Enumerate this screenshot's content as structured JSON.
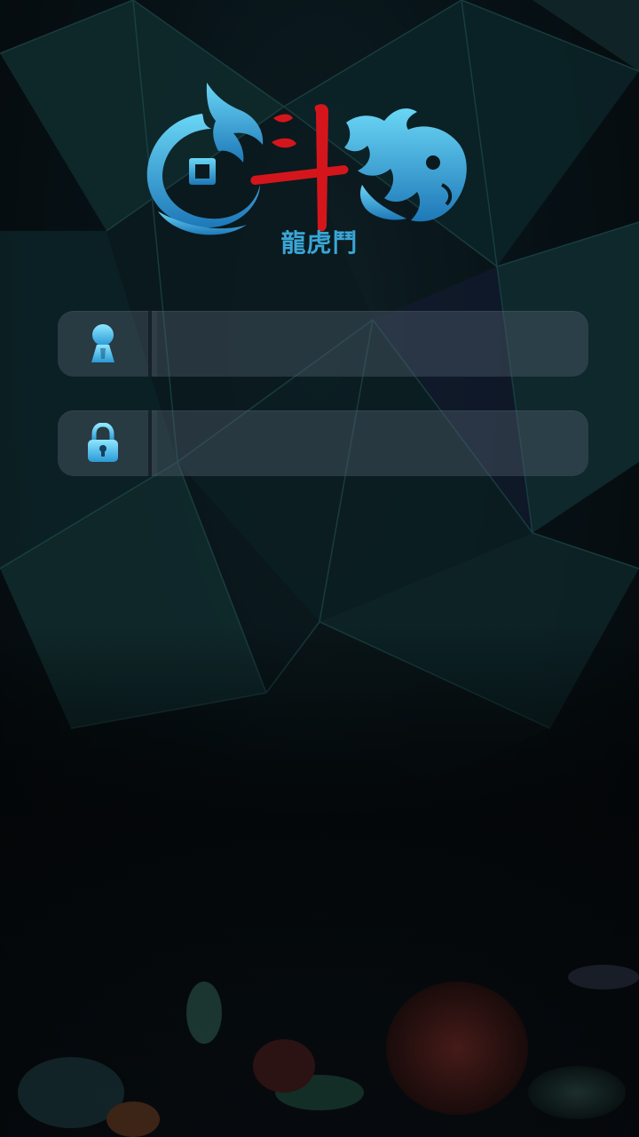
{
  "app": {
    "logo_text": "龍虎鬥",
    "logo_center_glyph": "斗",
    "subtitle": "龍虎鬥"
  },
  "login": {
    "username": {
      "value": "",
      "placeholder": "",
      "icon": "user-icon"
    },
    "password": {
      "value": "",
      "placeholder": "",
      "icon": "lock-icon"
    }
  },
  "colors": {
    "accent": "#3aa6d6",
    "brand_red": "#d4161c",
    "field_bg": "#3f4a55"
  }
}
